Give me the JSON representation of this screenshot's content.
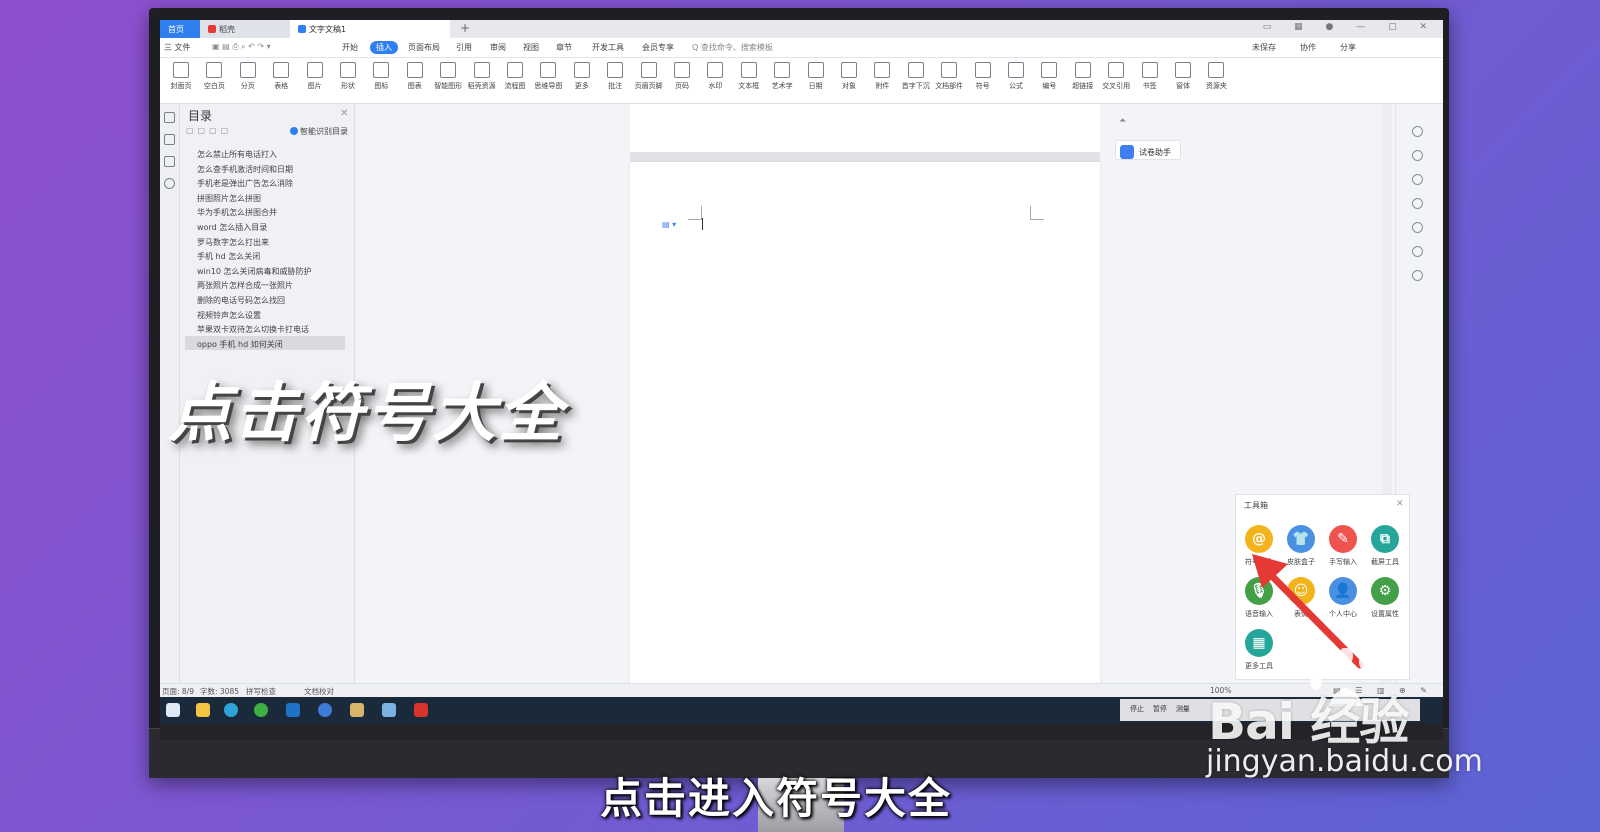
{
  "tabs": {
    "home": "首页",
    "daoke": "稻壳",
    "doc": "文字文稿1",
    "add": "+"
  },
  "menu": {
    "file": "三 文件",
    "items": [
      "开始",
      "插入",
      "页面布局",
      "引用",
      "审阅",
      "视图",
      "章节",
      "开发工具",
      "会员专享"
    ],
    "search": "Q 查找命令、搜索模板",
    "right": [
      "未保存",
      "协作",
      "分享"
    ]
  },
  "ribbon": [
    "封面页",
    "空白页",
    "分页",
    "表格",
    "图片",
    "形状",
    "图标",
    "图表",
    "智能图形",
    "稻壳资源",
    "流程图",
    "思维导图",
    "更多",
    "批注",
    "页眉页脚",
    "页码",
    "水印",
    "文本框",
    "艺术字",
    "日期",
    "对象",
    "附件",
    "首字下沉",
    "文档部件",
    "符号",
    "公式",
    "编号",
    "超链接",
    "交叉引用",
    "书签",
    "窗体",
    "资源夹"
  ],
  "toc": {
    "title": "目录",
    "smart": "智能识别目录",
    "items": [
      "怎么禁止所有电话打入",
      "怎么查手机激活时间和日期",
      "手机老是弹出广告怎么消除",
      "拼图照片怎么拼图",
      "华为手机怎么拼图合并",
      "word 怎么插入目录",
      "罗马数字怎么打出来",
      "手机 hd 怎么关闭",
      "win10 怎么关闭病毒和威胁防护",
      "两张照片怎样合成一张照片",
      "删除的电话号码怎么找回",
      "视频铃声怎么设置",
      "苹果双卡双待怎么切换卡打电话",
      "oppo 手机 hd 如何关闭"
    ],
    "selected_index": 13
  },
  "assistant": {
    "label": "试卷助手"
  },
  "toolbox": {
    "title": "工具箱",
    "tools": [
      {
        "label": "符号大全",
        "icon": "@",
        "color": "#f2b31b"
      },
      {
        "label": "皮肤盒子",
        "icon": "shirt-icon",
        "color": "#4a90e2"
      },
      {
        "label": "手写输入",
        "icon": "pen-icon",
        "color": "#ef5350"
      },
      {
        "label": "截屏工具",
        "icon": "crop-icon",
        "color": "#26a69a"
      },
      {
        "label": "语音输入",
        "icon": "mic-icon",
        "color": "#43a047"
      },
      {
        "label": "表情",
        "icon": "emoji-icon",
        "color": "#f2b31b"
      },
      {
        "label": "个人中心",
        "icon": "user-icon",
        "color": "#4a90e2"
      },
      {
        "label": "设置属性",
        "icon": "gear-icon",
        "color": "#43a047"
      },
      {
        "label": "更多工具",
        "icon": "grid-icon",
        "color": "#26a69a"
      }
    ]
  },
  "status": {
    "page": "页面: 8/9",
    "words": "字数: 3085",
    "spell": "拼写检查",
    "proof": "文档校对",
    "zoom": "100%"
  },
  "tray": {
    "a": "停止",
    "b": "暂停",
    "c": "测量"
  },
  "overlay": {
    "caption_big": "点击符号大全",
    "caption_sub": "点击进入符号大全"
  },
  "watermark": {
    "brand": "Bai 经验",
    "url": "jingyan.baidu.com"
  }
}
